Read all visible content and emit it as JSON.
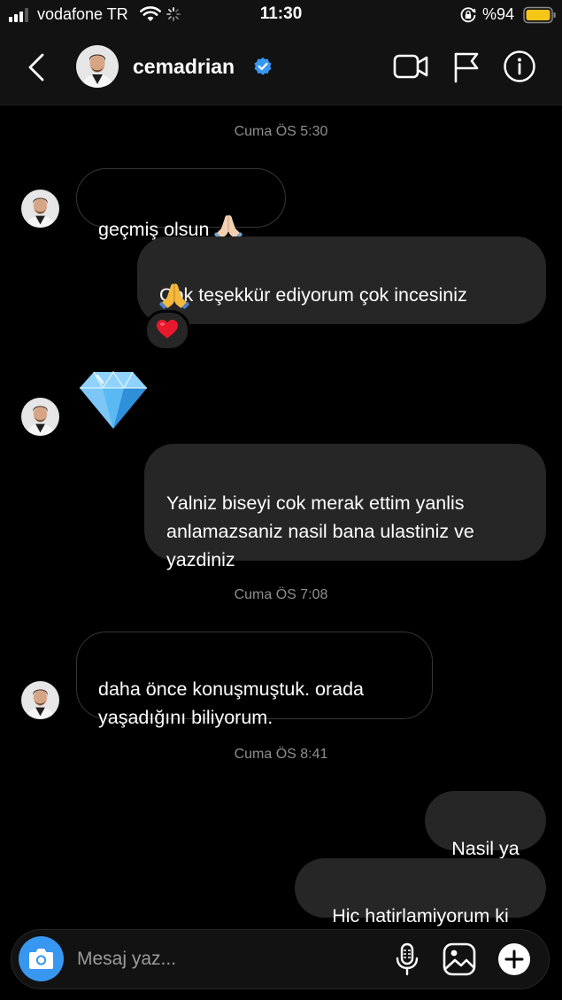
{
  "status_bar": {
    "carrier": "vodafone TR",
    "time": "11:30",
    "battery": "%94"
  },
  "header": {
    "username": "cemadrian",
    "verified": true
  },
  "messages": {
    "ts1": "Cuma ÖS 5:30",
    "m1": "geçmiş olsun",
    "m1_emoji": "folded-hands-light",
    "m2": "Cok teşekkür ediyorum çok incesiniz",
    "m2_emoji": "folded-hands",
    "m2_reaction": "red-heart",
    "m3_emoji": "gem-stone",
    "m4": "Yalniz biseyi cok merak ettim yanlis anlamazsaniz nasil bana ulastiniz ve yazdiniz",
    "ts2": "Cuma ÖS 7:08",
    "m5": "daha önce konuşmuştuk. orada yaşadığını biliyorum.",
    "ts3": "Cuma ÖS 8:41",
    "m6": "Nasil ya",
    "m7": "Hic hatirlamiyorum ki"
  },
  "composer": {
    "placeholder": "Mesaj yaz..."
  },
  "colors": {
    "background": "#000000",
    "bar": "#121212",
    "outgoing_bubble": "#262626",
    "incoming_border": "#363636",
    "timestamp": "#8e8e8e",
    "verified": "#3897f0",
    "camera_button": "#3897f0",
    "battery": "#f5c518"
  },
  "icons": [
    "signal-icon",
    "wifi-icon",
    "spinner-icon",
    "rotation-lock-icon",
    "battery-icon",
    "back-icon",
    "verified-icon",
    "video-camera-icon",
    "flag-icon",
    "info-icon",
    "camera-icon",
    "microphone-icon",
    "gallery-icon",
    "plus-icon"
  ]
}
